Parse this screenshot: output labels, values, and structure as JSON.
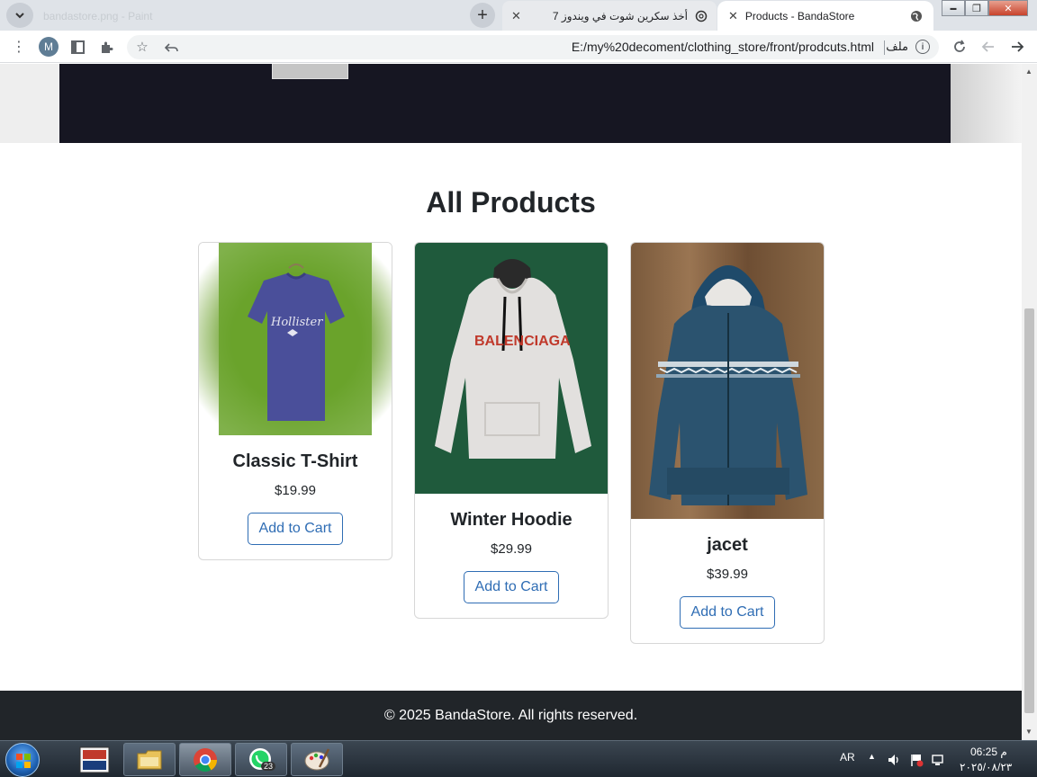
{
  "browser": {
    "ghost_tab_title": "bandastore.png - Paint",
    "tabs": [
      {
        "title": "أخذ سكرين شوت في ويندوز 7"
      },
      {
        "title": "Products - BandaStore"
      }
    ],
    "url": "E:/my%20decoment/clothing_store/front/prodcuts.html",
    "file_label": "ملف",
    "profile_initial": "M",
    "window_controls": {
      "minimize": "▬",
      "restore": "❐",
      "close": "✕"
    }
  },
  "page": {
    "section_title": "All Products",
    "products": [
      {
        "name": "Classic T-Shirt",
        "price": "$19.99",
        "button": "Add to Cart",
        "print": "Hollister"
      },
      {
        "name": "Winter Hoodie",
        "price": "$29.99",
        "button": "Add to Cart",
        "print": "BALENCIAGA"
      },
      {
        "name": "jacet",
        "price": "$39.99",
        "button": "Add to Cart"
      }
    ],
    "footer": "© 2025 BandaStore. All rights reserved."
  },
  "taskbar": {
    "language": "AR",
    "time": "06:25 م",
    "date": "٢٠٢٥/٠٨/٢٣",
    "whatsapp_badge": "23"
  },
  "colors": {
    "hero_dark": "#161622",
    "footer": "#212529",
    "button_outline": "#2f6db4",
    "taskbar": "#2a333d"
  }
}
